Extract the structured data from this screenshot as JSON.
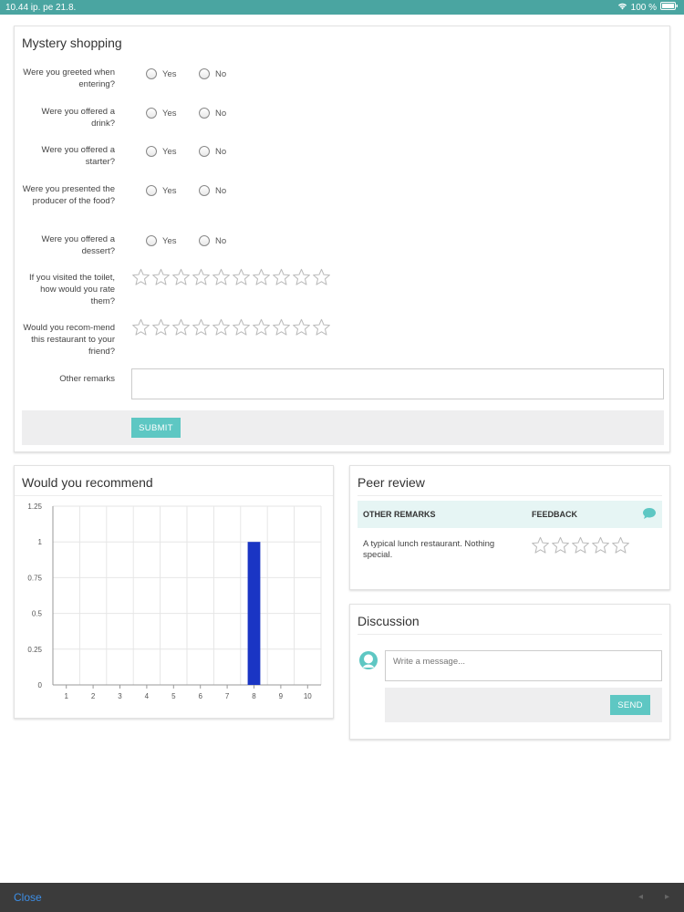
{
  "status": {
    "time": "10.44 ip.  pe 21.8.",
    "battery": "100 %"
  },
  "survey": {
    "title": "Mystery shopping",
    "questions": [
      {
        "label": "Were you greeted when entering?",
        "yes": "Yes",
        "no": "No"
      },
      {
        "label": "Were you offered a drink?",
        "yes": "Yes",
        "no": "No"
      },
      {
        "label": "Were you offered a starter?",
        "yes": "Yes",
        "no": "No"
      },
      {
        "label": "Were you presented the producer of the food?",
        "yes": "Yes",
        "no": "No"
      },
      {
        "label": "Were you offered a dessert?",
        "yes": "Yes",
        "no": "No"
      }
    ],
    "rating_toilet_label": "If you visited the toilet, how would you rate them?",
    "rating_recommend_label": "Would you recom-mend this restaurant to your friend?",
    "remarks_label": "Other remarks",
    "remarks_value": "",
    "submit_label": "SUBMIT"
  },
  "recommend_chart": {
    "title": "Would you recommend"
  },
  "chart_data": {
    "type": "bar",
    "categories": [
      "1",
      "2",
      "3",
      "4",
      "5",
      "6",
      "7",
      "8",
      "9",
      "10"
    ],
    "values": [
      0,
      0,
      0,
      0,
      0,
      0,
      0,
      1,
      0,
      0
    ],
    "y_ticks": [
      "0",
      "0.25",
      "0.5",
      "0.75",
      "1",
      "1.25"
    ],
    "ylim": [
      0,
      1.25
    ],
    "color": "#1a35c4",
    "grid": true
  },
  "peer_review": {
    "title": "Peer review",
    "col_remarks": "OTHER REMARKS",
    "col_feedback": "FEEDBACK",
    "remark_text": "A typical lunch restaurant. Nothing special."
  },
  "discussion": {
    "title": "Discussion",
    "message_placeholder": "Write a message...",
    "send_label": "SEND"
  },
  "footer": {
    "close_label": "Close"
  },
  "colors": {
    "accent": "#5ec7c3",
    "status_bar": "#4aa5a1",
    "bar": "#1a35c4"
  }
}
